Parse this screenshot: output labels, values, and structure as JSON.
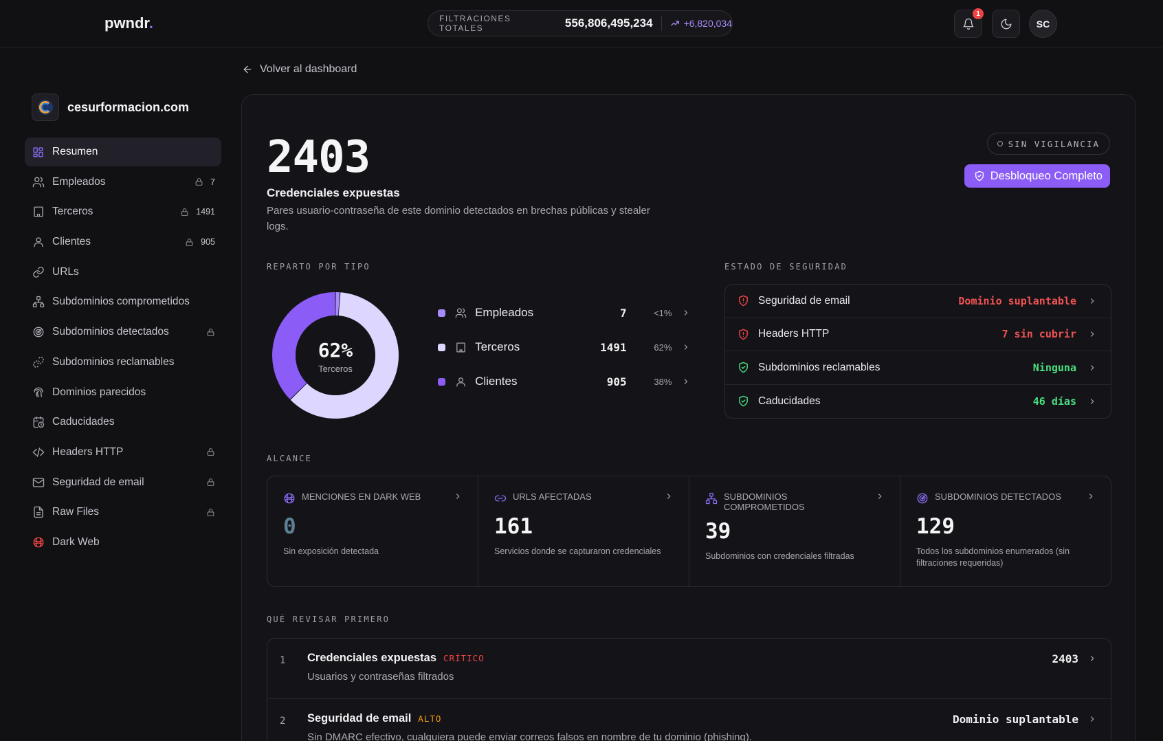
{
  "app": {
    "logo_text": "pwndr",
    "logo_dot": "."
  },
  "header": {
    "leak_label": "FILTRACIONES TOTALES",
    "leak_value": "556,806,495,234",
    "leak_delta": "+6,820,034",
    "notifications_count": "1",
    "avatar_initials": "SC"
  },
  "back_link": "Volver al dashboard",
  "sidebar": {
    "domain": "cesurformacion.com",
    "items": [
      {
        "label": "Resumen",
        "icon": "grid-icon",
        "active": true
      },
      {
        "label": "Empleados",
        "icon": "users-icon",
        "locked": true,
        "count": "7"
      },
      {
        "label": "Terceros",
        "icon": "building-icon",
        "locked": true,
        "count": "1491"
      },
      {
        "label": "Clientes",
        "icon": "user-icon",
        "locked": true,
        "count": "905"
      },
      {
        "label": "URLs",
        "icon": "link-icon"
      },
      {
        "label": "Subdominios comprometidos",
        "icon": "network-icon"
      },
      {
        "label": "Subdominios detectados",
        "icon": "radar-icon",
        "locked": true
      },
      {
        "label": "Subdominios reclamables",
        "icon": "dashed-link-icon"
      },
      {
        "label": "Dominios parecidos",
        "icon": "fingerprint-icon"
      },
      {
        "label": "Caducidades",
        "icon": "calendar-clock-icon"
      },
      {
        "label": "Headers HTTP",
        "icon": "code-icon",
        "locked": true
      },
      {
        "label": "Seguridad de email",
        "icon": "mail-icon",
        "locked": true
      },
      {
        "label": "Raw Files",
        "icon": "file-icon",
        "locked": true
      },
      {
        "label": "Dark Web",
        "icon": "darkweb-icon"
      }
    ]
  },
  "summary": {
    "count": "2403",
    "title": "Credenciales expuestas",
    "description": "Pares usuario-contraseña de este dominio detectados en brechas públicas y stealer logs.",
    "status_pill": "SIN VIGILANCIA",
    "unlock_button": "Desbloqueo Completo"
  },
  "breakdown": {
    "label": "REPARTO POR TIPO",
    "center_value": "62%",
    "center_label": "Terceros",
    "rows": [
      {
        "name": "Empleados",
        "value": "7",
        "pct": "<1%",
        "color": "#a78bfa",
        "icon": "users-icon"
      },
      {
        "name": "Terceros",
        "value": "1491",
        "pct": "62%",
        "color": "#ddd6fe",
        "icon": "building-icon"
      },
      {
        "name": "Clientes",
        "value": "905",
        "pct": "38%",
        "color": "#8b5cf6",
        "icon": "user-icon"
      }
    ]
  },
  "chart_data": {
    "type": "pie",
    "categories": [
      "Empleados",
      "Terceros",
      "Clientes"
    ],
    "values": [
      7,
      1491,
      905
    ],
    "center_text": "62%",
    "center_subtitle": "Terceros",
    "colors": [
      "#a78bfa",
      "#ddd6fe",
      "#8b5cf6"
    ]
  },
  "security": {
    "label": "ESTADO DE SEGURIDAD",
    "rows": [
      {
        "name": "Seguridad de email",
        "value": "Dominio suplantable",
        "status": "bad"
      },
      {
        "name": "Headers HTTP",
        "value": "7 sin cubrir",
        "status": "bad"
      },
      {
        "name": "Subdominios reclamables",
        "value": "Ninguna",
        "status": "good"
      },
      {
        "name": "Caducidades",
        "value": "46 días",
        "status": "good"
      }
    ]
  },
  "reach": {
    "label": "ALCANCE",
    "cards": [
      {
        "title": "MENCIONES EN DARK WEB",
        "value": "0",
        "desc": "Sin exposición detectada",
        "icon": "darkweb-icon"
      },
      {
        "title": "URLS AFECTADAS",
        "value": "161",
        "desc": "Servicios donde se capturaron credenciales",
        "icon": "link-icon"
      },
      {
        "title": "SUBDOMINIOS COMPROMETIDOS",
        "value": "39",
        "desc": "Subdominios con credenciales filtradas",
        "icon": "network-icon"
      },
      {
        "title": "SUBDOMINIOS DETECTADOS",
        "value": "129",
        "desc": "Todos los subdominios enumerados (sin filtraciones requeridas)",
        "icon": "radar-icon"
      }
    ]
  },
  "review": {
    "label": "QUÉ REVISAR PRIMERO",
    "rows": [
      {
        "num": "1",
        "title": "Credenciales expuestas",
        "tag": "CRÍTICO",
        "tag_color": "#ef4444",
        "desc": "Usuarios y contraseñas filtrados",
        "value": "2403"
      },
      {
        "num": "2",
        "title": "Seguridad de email",
        "tag": "ALTO",
        "tag_color": "#f59e0b",
        "desc": "Sin DMARC efectivo, cualquiera puede enviar correos falsos en nombre de tu dominio (phishing).",
        "value": "Dominio suplantable"
      }
    ]
  },
  "colors": {
    "accent": "#8b5cf6",
    "danger": "#ef4444",
    "success": "#4ade80",
    "warning": "#f59e0b"
  }
}
